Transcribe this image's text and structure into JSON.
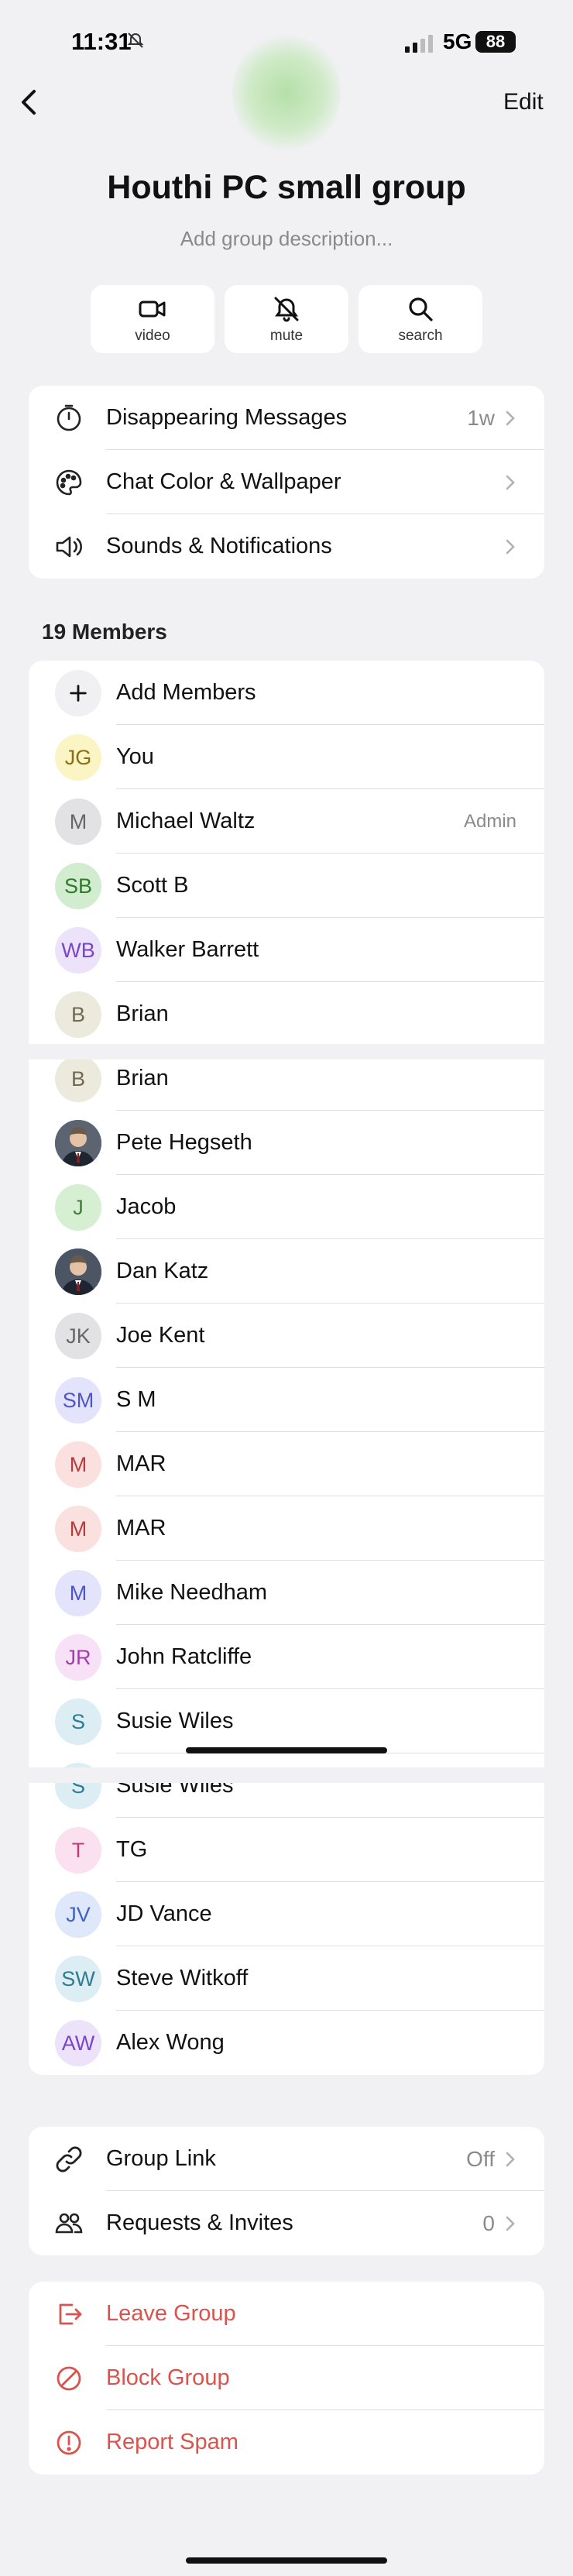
{
  "status_bar": {
    "time": "11:31",
    "network": "5G",
    "battery": "88"
  },
  "header": {
    "edit_label": "Edit"
  },
  "group": {
    "title": "Houthi PC small group",
    "description_placeholder": "Add group description..."
  },
  "actions": [
    {
      "label": "video",
      "icon": "video-icon"
    },
    {
      "label": "mute",
      "icon": "bell-slash-icon"
    },
    {
      "label": "search",
      "icon": "search-icon"
    }
  ],
  "settings": [
    {
      "label": "Disappearing Messages",
      "value": "1w",
      "icon": "timer-icon"
    },
    {
      "label": "Chat Color & Wallpaper",
      "value": "",
      "icon": "palette-icon"
    },
    {
      "label": "Sounds & Notifications",
      "value": "",
      "icon": "speaker-icon"
    }
  ],
  "members_header": "19 Members",
  "add_members_label": "Add Members",
  "members": [
    {
      "initials": "JG",
      "name": "You",
      "bg": "#fbf4c4",
      "fg": "#8a6e14"
    },
    {
      "initials": "M",
      "name": "Michael Waltz",
      "badge": "Admin",
      "bg": "#e2e2e4",
      "fg": "#666"
    },
    {
      "initials": "SB",
      "name": "Scott B",
      "bg": "#d2ecd0",
      "fg": "#2f7a2a"
    },
    {
      "initials": "WB",
      "name": "Walker Barrett",
      "bg": "#ece2fa",
      "fg": "#7b45c8"
    },
    {
      "initials": "B",
      "name": "Brian",
      "bg": "#ebeadc",
      "fg": "#6d6b53"
    },
    {
      "initials": "B",
      "name": "Brian",
      "bg": "#ebeadc",
      "fg": "#6d6b53"
    },
    {
      "initials": "",
      "name": "Pete Hegseth",
      "photo": true,
      "bg": "#5b6470",
      "fg": "#fff"
    },
    {
      "initials": "J",
      "name": "Jacob",
      "bg": "#d6efd2",
      "fg": "#3f7f36"
    },
    {
      "initials": "",
      "name": "Dan Katz",
      "photo": true,
      "bg": "#4b5563",
      "fg": "#fff"
    },
    {
      "initials": "JK",
      "name": "Joe Kent",
      "bg": "#e2e2e4",
      "fg": "#666"
    },
    {
      "initials": "SM",
      "name": "S M",
      "bg": "#e3e4fb",
      "fg": "#4e55c7"
    },
    {
      "initials": "M",
      "name": "MAR",
      "bg": "#fbe0e0",
      "fg": "#b83b3b"
    },
    {
      "initials": "M",
      "name": "MAR",
      "bg": "#fbe0e0",
      "fg": "#b83b3b"
    },
    {
      "initials": "M",
      "name": "Mike Needham",
      "bg": "#e3e4fb",
      "fg": "#4e55c7"
    },
    {
      "initials": "JR",
      "name": "John Ratcliffe",
      "bg": "#f6e1f7",
      "fg": "#a43cab"
    },
    {
      "initials": "S",
      "name": "Susie Wiles",
      "bg": "#dceef4",
      "fg": "#2e7b93"
    },
    {
      "initials": "S",
      "name": "Susie Wiles",
      "bg": "#dceef4",
      "fg": "#2e7b93"
    },
    {
      "initials": "T",
      "name": "TG",
      "bg": "#fbe0ef",
      "fg": "#c23a7c"
    },
    {
      "initials": "JV",
      "name": "JD Vance",
      "bg": "#dfe7fa",
      "fg": "#3f64bd"
    },
    {
      "initials": "SW",
      "name": "Steve Witkoff",
      "bg": "#dceef4",
      "fg": "#2e7b93"
    },
    {
      "initials": "AW",
      "name": "Alex Wong",
      "bg": "#ece2fa",
      "fg": "#7b45c8"
    }
  ],
  "link_section": [
    {
      "label": "Group Link",
      "value": "Off",
      "icon": "link-icon"
    },
    {
      "label": "Requests & Invites",
      "value": "0",
      "icon": "people-icon"
    }
  ],
  "danger_section": [
    {
      "label": "Leave Group",
      "icon": "leave-icon"
    },
    {
      "label": "Block Group",
      "icon": "block-icon"
    },
    {
      "label": "Report Spam",
      "icon": "alert-icon"
    }
  ],
  "colors": {
    "danger": "#d9534f",
    "secondary_text": "#8a8a8e",
    "background": "#f1f1f4"
  }
}
